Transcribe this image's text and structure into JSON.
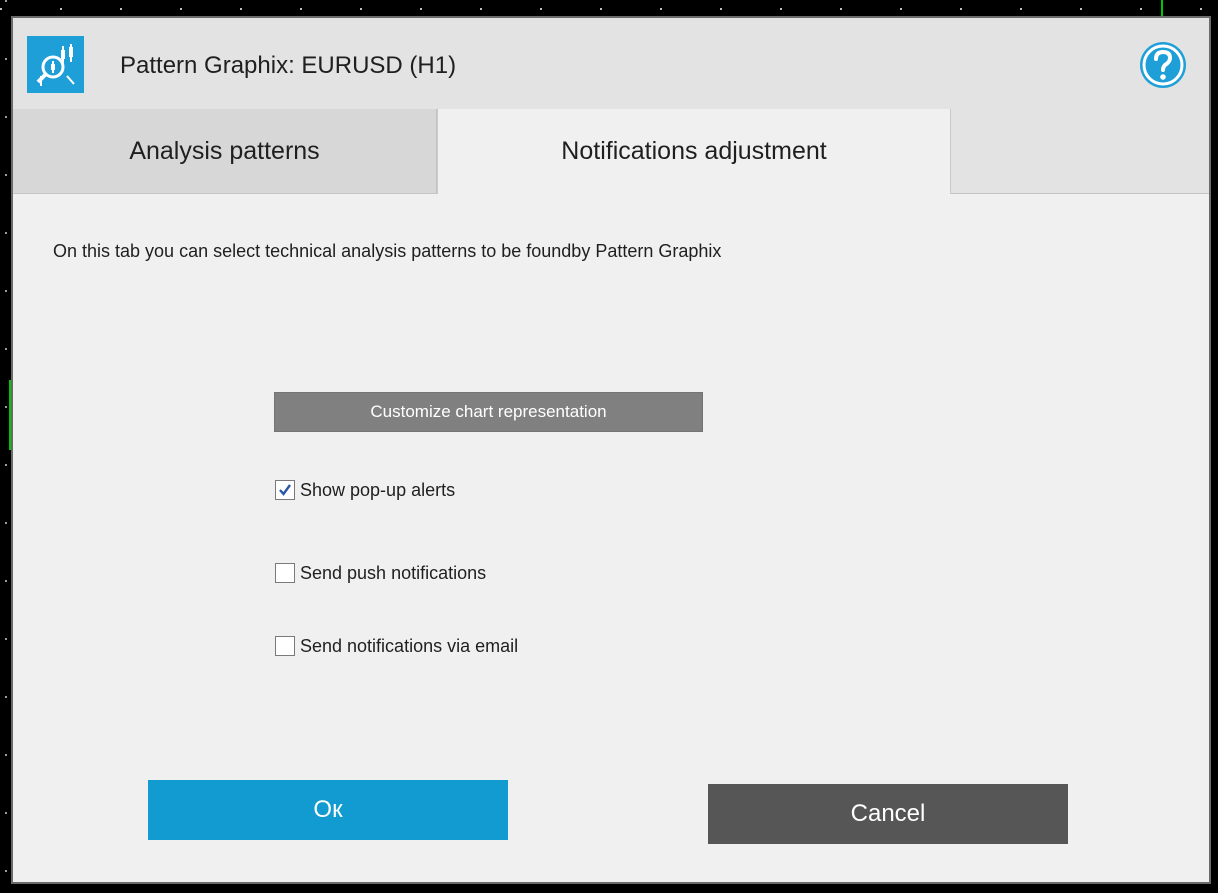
{
  "window": {
    "title": "Pattern Graphix: EURUSD (H1)",
    "app_icon": "pattern-graphix-logo-icon",
    "help_icon": "question-mark-icon",
    "accent_color": "#1e9fd8"
  },
  "tabs": [
    {
      "label": "Analysis patterns",
      "active": false
    },
    {
      "label": "Notifications adjustment",
      "active": true
    }
  ],
  "content": {
    "description": "On this tab you can select technical analysis patterns  to be foundby Pattern Graphix",
    "customize_button": "Customize chart representation",
    "options": [
      {
        "label": "Show pop-up alerts",
        "checked": true
      },
      {
        "label": "Send push notifications",
        "checked": false
      },
      {
        "label": "Send notifications via email",
        "checked": false
      }
    ]
  },
  "footer": {
    "ok_label": "Ок",
    "cancel_label": "Cancel",
    "ok_color": "#119bd1",
    "cancel_color": "#565656"
  }
}
